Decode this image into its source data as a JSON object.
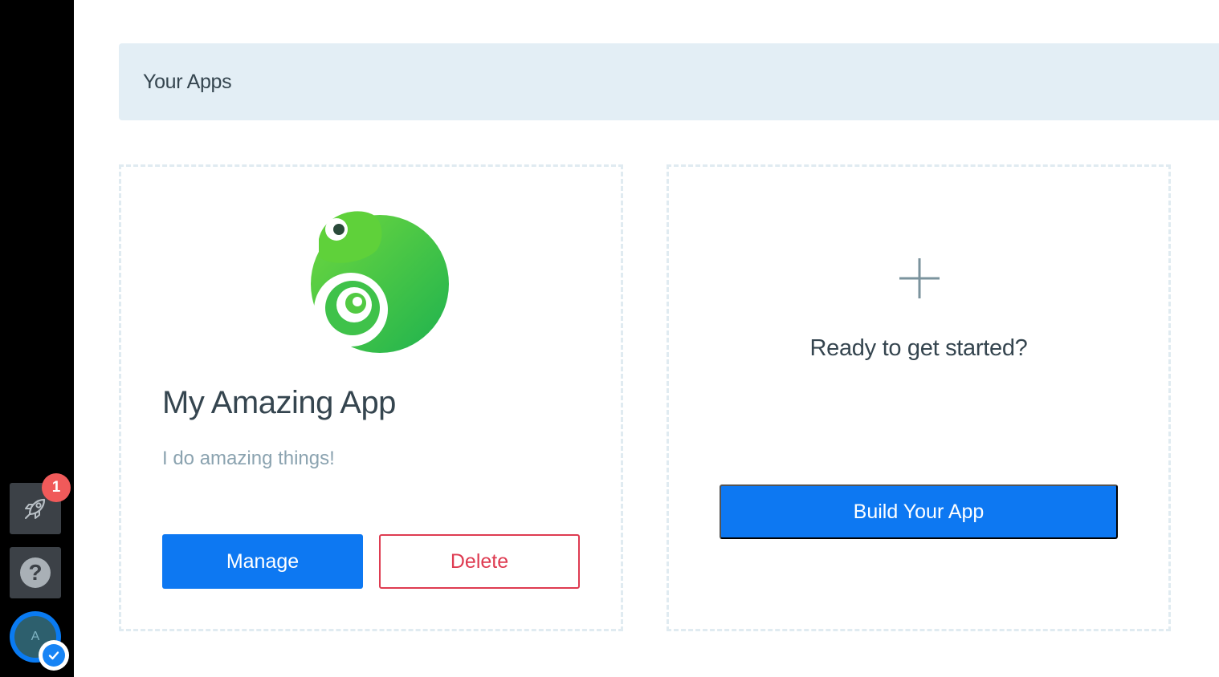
{
  "sidebar": {
    "rocket_badge": "1",
    "help_glyph": "?",
    "avatar_initial": "A",
    "icons": {
      "launch": "rocket-icon",
      "help": "question-circle-icon",
      "verified": "check-icon"
    }
  },
  "header": {
    "title": "Your Apps"
  },
  "app_card": {
    "name": "My Amazing App",
    "description": "I do amazing things!",
    "manage_label": "Manage",
    "delete_label": "Delete",
    "logo_icon": "chameleon-logo-icon"
  },
  "new_app_card": {
    "prompt": "Ready to get started?",
    "build_label": "Build Your App",
    "add_icon": "plus-icon"
  },
  "colors": {
    "primary": "#0d78f2",
    "danger": "#de3b51",
    "header_bg": "#e3eef5",
    "sidebar_bg": "#000000",
    "badge": "#f05a5a"
  }
}
